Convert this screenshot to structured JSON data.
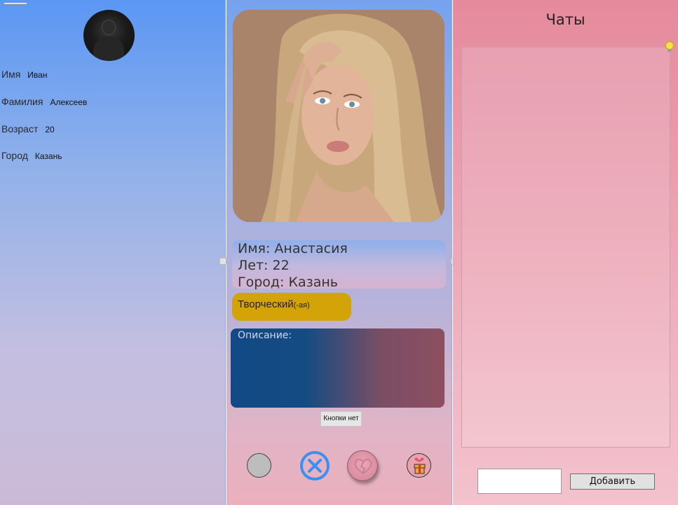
{
  "profile": {
    "name_label": "Имя",
    "name_value": "Иван",
    "surname_label": "Фамилия",
    "surname_value": "Алексеев",
    "age_label": "Возраст",
    "age_value": "20",
    "city_label": "Город",
    "city_value": "Казань"
  },
  "card": {
    "name_line": "Имя:  Анастасия",
    "age_line": "Лет: 22",
    "city_line": "Город: Казань",
    "tag_main": "Творческий",
    "tag_suffix": "(-ая)",
    "description_label": "Описание:",
    "no_button_label": "Кнопки нет"
  },
  "actions": {
    "icons": [
      "gray-circle-icon",
      "close-x-icon",
      "broken-heart-icon",
      "gift-icon"
    ],
    "x_color": "#3b8ff0"
  },
  "chats": {
    "title": "Чаты",
    "input_value": "",
    "add_button_label": "Добавить"
  },
  "colors": {
    "tag_bg": "#d4a308",
    "left_gradient_top": "#5b97f4",
    "right_gradient_top": "#e58a9c"
  }
}
